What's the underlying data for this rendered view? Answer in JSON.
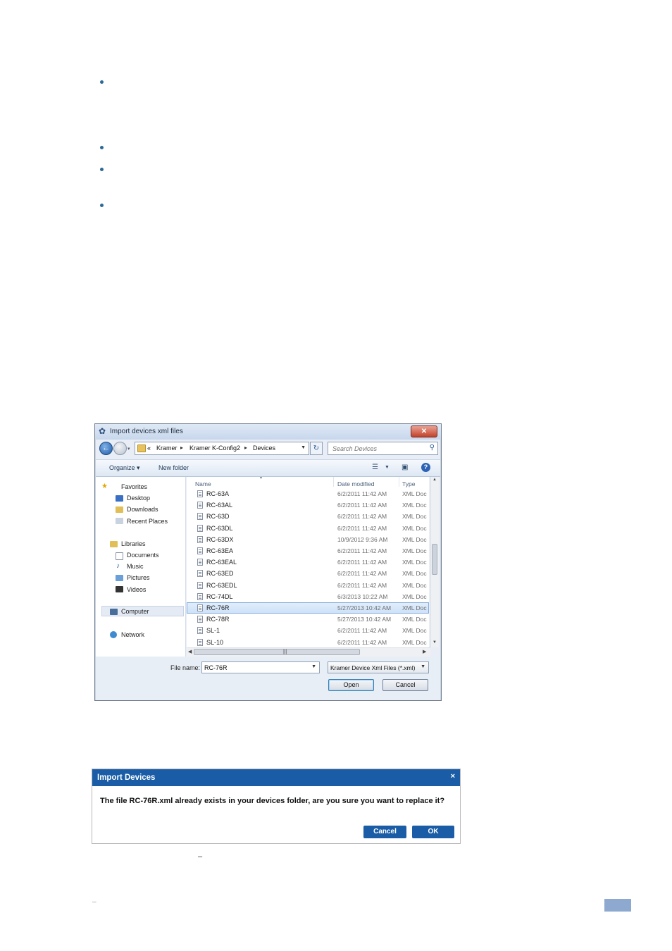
{
  "dialog": {
    "title": "Import devices xml files",
    "breadcrumb": [
      "«",
      "Kramer",
      "Kramer K-Config2",
      "Devices"
    ],
    "search_placeholder": "Search Devices",
    "toolbar": {
      "organize": "Organize ▾",
      "new_folder": "New folder",
      "help": "?"
    },
    "nav": {
      "favorites": "Favorites",
      "desktop": "Desktop",
      "downloads": "Downloads",
      "recent": "Recent Places",
      "libraries": "Libraries",
      "documents": "Documents",
      "music": "Music",
      "pictures": "Pictures",
      "videos": "Videos",
      "computer": "Computer",
      "network": "Network"
    },
    "columns": {
      "name": "Name",
      "date": "Date modified",
      "type": "Type"
    },
    "files": [
      {
        "name": "RC-63A",
        "date": "6/2/2011 11:42 AM",
        "type": "XML Doc"
      },
      {
        "name": "RC-63AL",
        "date": "6/2/2011 11:42 AM",
        "type": "XML Doc"
      },
      {
        "name": "RC-63D",
        "date": "6/2/2011 11:42 AM",
        "type": "XML Doc"
      },
      {
        "name": "RC-63DL",
        "date": "6/2/2011 11:42 AM",
        "type": "XML Doc"
      },
      {
        "name": "RC-63DX",
        "date": "10/9/2012 9:36 AM",
        "type": "XML Doc"
      },
      {
        "name": "RC-63EA",
        "date": "6/2/2011 11:42 AM",
        "type": "XML Doc"
      },
      {
        "name": "RC-63EAL",
        "date": "6/2/2011 11:42 AM",
        "type": "XML Doc"
      },
      {
        "name": "RC-63ED",
        "date": "6/2/2011 11:42 AM",
        "type": "XML Doc"
      },
      {
        "name": "RC-63EDL",
        "date": "6/2/2011 11:42 AM",
        "type": "XML Doc"
      },
      {
        "name": "RC-74DL",
        "date": "6/3/2013 10:22 AM",
        "type": "XML Doc"
      },
      {
        "name": "RC-76R",
        "date": "5/27/2013 10:42 AM",
        "type": "XML Doc"
      },
      {
        "name": "RC-78R",
        "date": "5/27/2013 10:42 AM",
        "type": "XML Doc"
      },
      {
        "name": "SL-1",
        "date": "6/2/2011 11:42 AM",
        "type": "XML Doc"
      },
      {
        "name": "SL-10",
        "date": "6/2/2011 11:42 AM",
        "type": "XML Doc"
      }
    ],
    "selected_file_index": 10,
    "filename_label": "File name:",
    "filename_value": "RC-76R",
    "filetype_value": "Kramer Device Xml Files (*.xml)",
    "open_label": "Open",
    "cancel_label": "Cancel"
  },
  "confirm": {
    "title": "Import Devices",
    "close": "×",
    "message": "The file RC-76R.xml already exists in your devices folder, are you sure you want to replace it?",
    "cancel_label": "Cancel",
    "ok_label": "OK"
  },
  "page": {
    "dash_a": "–",
    "dash_b": "–"
  }
}
